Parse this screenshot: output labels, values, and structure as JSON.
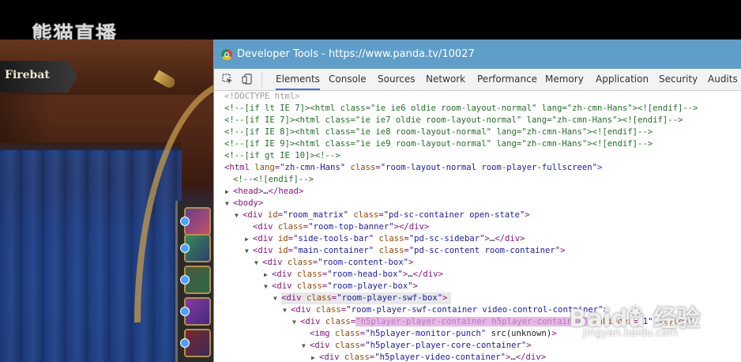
{
  "header": {
    "logo_text": "熊猫直播"
  },
  "stream": {
    "player_name": "Firebat"
  },
  "devtools": {
    "window_title": "Developer Tools - https://www.panda.tv/10027",
    "tabs": [
      {
        "label": "Elements"
      },
      {
        "label": "Console"
      },
      {
        "label": "Sources"
      },
      {
        "label": "Network"
      },
      {
        "label": "Performance"
      },
      {
        "label": "Memory"
      },
      {
        "label": "Application"
      },
      {
        "label": "Security"
      },
      {
        "label": "Audits"
      }
    ],
    "active_tab": "Elements",
    "lines": [
      {
        "text": "<!DOCTYPE html>"
      },
      {
        "text": "<!--[if lt IE 7]><html class=\"ie ie6 oldie room-layout-normal\" lang=\"zh-cmn-Hans\"><![endif]-->"
      },
      {
        "text": "<!--[if IE 7]><html class=\"ie ie7 oldie room-layout-normal\" lang=\"zh-cmn-Hans\"><![endif]-->"
      },
      {
        "text": "<!--[if IE 8]><html class=\"ie ie8 room-layout-normal\" lang=\"zh-cmn-Hans\"><![endif]-->"
      },
      {
        "text": "<!--[if IE 9]><html class=\"ie ie9 room-layout-normal\" lang=\"zh-cmn-Hans\"><![endif]-->"
      },
      {
        "text": "<!--[if gt IE 10]><!-->"
      },
      {
        "text": "<html lang=\"zh-cmn-Hans\" class=\"room-layout-normal room-player-fullscreen\">"
      },
      {
        "text": "<!--<![endif]-->"
      },
      {
        "text": "<head>…</head>"
      },
      {
        "text": "<body>"
      },
      {
        "text": "<div id=\"room_matrix\" class=\"pd-sc-container open-state\">"
      },
      {
        "text": "<div class=\"room-top-banner\"></div>"
      },
      {
        "text": "<div id=\"side-tools-bar\" class=\"pd-sc-sidebar\">…</div>"
      },
      {
        "text": "<div id=\"main-container\" class=\"pd-sc-content room-container\">"
      },
      {
        "text": "<div class=\"room-content-box\">"
      },
      {
        "text": "<div class=\"room-head-box\">…</div>"
      },
      {
        "text": "<div class=\"room-player-box\">"
      },
      {
        "text": "<div class=\"room-player-swf-box\">"
      },
      {
        "text": "<div class=\"room-player-swf-container video-control-container\">"
      },
      {
        "text": "<div class=\"h5player-player-container h5player-container\" tabindex=\"1\" style=\""
      },
      {
        "text": "<img class=\"h5player-monitor-punch\" src(unknown)>"
      },
      {
        "text": "<div class=\"h5player-player-core-container\">"
      },
      {
        "text": "<div class=\"h5player-video-container\">…</div>"
      }
    ]
  },
  "watermark": {
    "brand": "Baidu 经验",
    "url": "jingyan.baidu.com"
  }
}
